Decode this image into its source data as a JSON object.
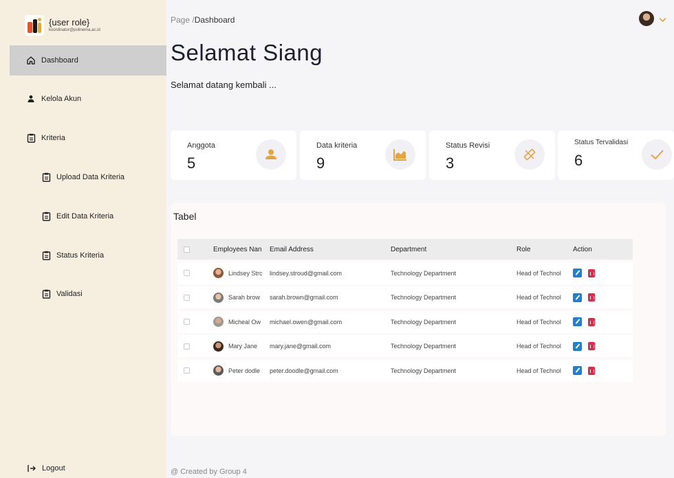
{
  "brand": {
    "title": "{user role}",
    "email": "koordinator@polinema.ac.id"
  },
  "sidebar": {
    "items": [
      {
        "label": "Dashboard",
        "icon": "home-icon"
      },
      {
        "label": "Kelola Akun",
        "icon": "user-icon"
      },
      {
        "label": "Kriteria",
        "icon": "clipboard-icon"
      },
      {
        "label": "Upload Data Kriteria",
        "icon": "clipboard-icon"
      },
      {
        "label": "Edit Data Kriteria",
        "icon": "clipboard-icon"
      },
      {
        "label": "Status Kriteria",
        "icon": "clipboard-icon"
      },
      {
        "label": "Validasi",
        "icon": "clipboard-icon"
      }
    ],
    "logout": "Logout"
  },
  "header": {
    "breadcrumb_page": "Page /",
    "breadcrumb_current": "Dashboard"
  },
  "greeting": {
    "title": "Selamat Siang",
    "subtitle": "Selamat datang kembali ..."
  },
  "stats": [
    {
      "label": "Anggota",
      "value": "5",
      "icon": "person-icon",
      "color": "#e7a43b"
    },
    {
      "label": "Data kriteria",
      "value": "9",
      "icon": "chart-icon",
      "color": "#e7a43b"
    },
    {
      "label": "Status Revisi",
      "value": "3",
      "icon": "pencil-icon",
      "color": "#e7a43b"
    },
    {
      "label": "Status Tervalidasi",
      "value": "6",
      "icon": "check-icon",
      "color": "#e7a43b"
    }
  ],
  "table": {
    "title": "Tabel",
    "headers": [
      "Employees Nan",
      "Email Address",
      "Department",
      "Role",
      "Action"
    ],
    "rows": [
      {
        "name": "Lindsey Strc",
        "email": "lindsey.stroud@gmail.com",
        "department": "Technology Department",
        "role": "Head of Technol"
      },
      {
        "name": "Sarah brow",
        "email": "sarah.brown@gmail.com",
        "department": "Technology Department",
        "role": "Head of Technol"
      },
      {
        "name": "Micheal Ow",
        "email": "michael.owen@gmail.com",
        "department": "Technology Department",
        "role": "Head of Technol"
      },
      {
        "name": "Mary Jane",
        "email": "mary.jane@gmail.com",
        "department": "Technology Department",
        "role": "Head of Technol"
      },
      {
        "name": "Peter dodle",
        "email": "peter.doodle@gmail.com",
        "department": "Technology Department",
        "role": "Head of Technol"
      }
    ]
  },
  "footer": "@ Created by Group 4",
  "colors": {
    "sidebar_bg": "#f6efe0",
    "accent": "#e7a43b",
    "edit": "#1e7fd6",
    "delete": "#e02a4a"
  }
}
